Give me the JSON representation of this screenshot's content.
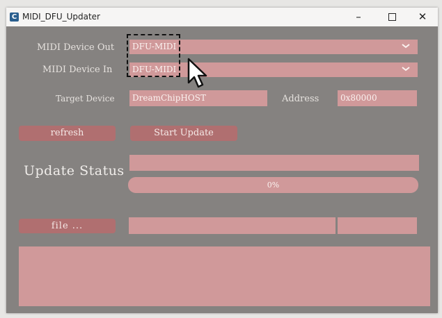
{
  "window": {
    "title": "MIDI_DFU_Updater",
    "app_icon_letter": "C"
  },
  "controls": {
    "minimize": "–",
    "close": "✕"
  },
  "labels": {
    "midi_out": "MIDI Device Out",
    "midi_in": "MIDI Device In",
    "target_device": "Target Device",
    "address": "Address",
    "update_status": "Update Status"
  },
  "fields": {
    "midi_out_value": "DFU-MIDI",
    "midi_in_value": "DFU-MIDI",
    "target_device_value": "DreamChipHOST",
    "address_value": "0x80000",
    "status_value": "",
    "file_path_value": "",
    "file_extra_value": "",
    "log_value": ""
  },
  "buttons": {
    "refresh": "refresh",
    "start_update": "Start Update",
    "file": "file ..."
  },
  "progress": {
    "value": 0,
    "label": "0%"
  },
  "icons": {
    "app": "app-icon",
    "midi_out_dropdown": "chevron-down-icon",
    "midi_in_dropdown": "chevron-down-icon",
    "cursor": "mouse-pointer-icon"
  },
  "colors": {
    "window_bg": "#858280",
    "field_bg": "#d0999a",
    "button_bg": "#b06f70",
    "titlebar_bg": "#f6f5f4"
  }
}
